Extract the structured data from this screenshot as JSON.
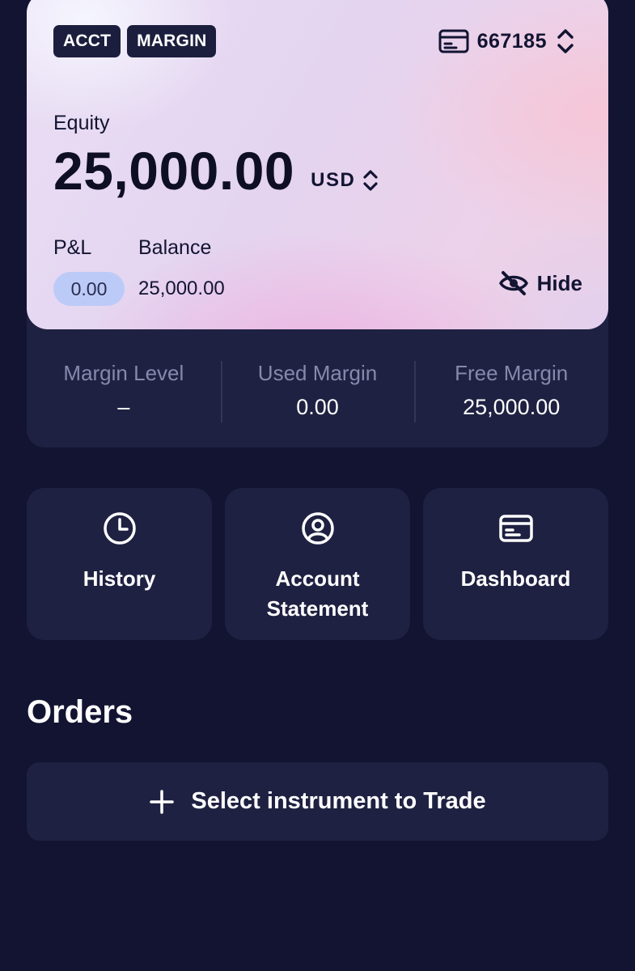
{
  "account": {
    "badges": [
      "ACCT",
      "MARGIN"
    ],
    "number": "667185"
  },
  "equity": {
    "label": "Equity",
    "value": "25,000.00",
    "currency": "USD"
  },
  "pl": {
    "label": "P&L",
    "value": "0.00"
  },
  "balance": {
    "label": "Balance",
    "value": "25,000.00"
  },
  "hide_label": "Hide",
  "stats": [
    {
      "label": "Margin Level",
      "value": "–"
    },
    {
      "label": "Used Margin",
      "value": "0.00"
    },
    {
      "label": "Free Margin",
      "value": "25,000.00"
    }
  ],
  "actions": [
    {
      "label": "History",
      "icon": "clock-icon"
    },
    {
      "label": "Account\nStatement",
      "icon": "user-circle-icon"
    },
    {
      "label": "Dashboard",
      "icon": "card-icon"
    }
  ],
  "orders": {
    "title": "Orders",
    "select_label": "Select instrument to Trade"
  },
  "colors": {
    "background": "#121432",
    "panel": "#1f2142",
    "pl_pill": "#bccaf7",
    "muted_text": "#8489ad"
  }
}
